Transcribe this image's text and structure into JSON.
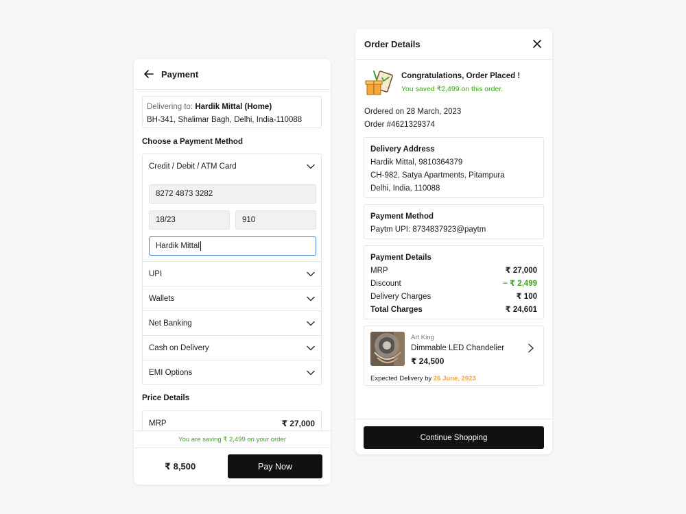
{
  "payment": {
    "title": "Payment",
    "delivering_prefix": "Delivering to:",
    "delivering_name": "Hardik Mittal (Home)",
    "delivering_address": "BH-341, Shalimar Bagh, Delhi, India-110088",
    "choose_label": "Choose a Payment Method",
    "card_method_label": "Credit / Debit / ATM Card",
    "card_number": "8272 4873 3282",
    "card_expiry": "18/23",
    "card_cvv": "910",
    "card_name": "Hardik Mittal",
    "methods": [
      "UPI",
      "Wallets",
      "Net Banking",
      "Cash on Delivery",
      "EMI Options"
    ],
    "price_details_label": "Price Details",
    "mrp_label": "MRP",
    "mrp_value": "₹ 27,000",
    "saving_text": "You are saving ₹ 2,499 on your order",
    "total": "₹ 8,500",
    "pay_button": "Pay Now"
  },
  "order": {
    "title": "Order Details",
    "congrats": "Congratulations, Order Placed !",
    "saved": "You saved ₹2,499 on this order.",
    "ordered_on": "Ordered on 28 March, 2023",
    "order_number": "Order #4621329374",
    "delivery_address": {
      "heading": "Delivery Address",
      "lines": [
        "Hardik Mittal, 9810364379",
        "CH-982, Satya Apartments, Pitampura",
        "Delhi, India, 110088"
      ]
    },
    "payment_method": {
      "heading": "Payment Method",
      "value": "Paytm UPI: 8734837923@paytm"
    },
    "payment_details": {
      "heading": "Payment Details",
      "rows": [
        {
          "label": "MRP",
          "value": "₹ 27,000"
        },
        {
          "label": "Discount",
          "value": "− ₹ 2,499"
        },
        {
          "label": "Delivery Charges",
          "value": "₹ 100"
        },
        {
          "label": "Total Charges",
          "value": "₹ 24,601"
        }
      ]
    },
    "product": {
      "brand": "Art King",
      "name": "Dimmable LED Chandelier",
      "price": "₹ 24,500",
      "delivery_prefix": "Expected Delivery by",
      "delivery_date": "26 June, 2023"
    },
    "continue_button": "Continue Shopping"
  },
  "colors": {
    "accent_green": "#3fa31e",
    "delivery_orange": "#f0a33a",
    "button_dark": "#111111",
    "focus_blue": "#4a7fd0"
  },
  "icons": [
    "back-arrow-icon",
    "chevron-down-icon",
    "close-icon",
    "gift-box-icon",
    "chevron-right-icon"
  ]
}
